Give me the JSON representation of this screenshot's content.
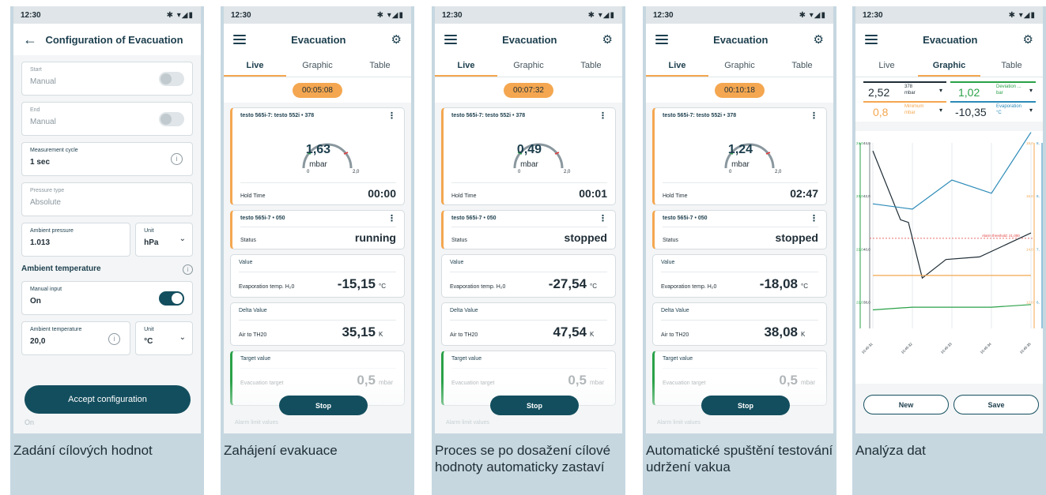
{
  "status": {
    "time": "12:30",
    "icons": "✱ ▾◢▮"
  },
  "panel1": {
    "title": "Configuration of Evacuation",
    "start": {
      "label": "Start",
      "value": "Manual"
    },
    "end": {
      "label": "End",
      "value": "Manual"
    },
    "cycle": {
      "label": "Measurement cycle",
      "value": "1 sec"
    },
    "ptype": {
      "label": "Pressure type",
      "value": "Absolute"
    },
    "ambient_pressure": {
      "label": "Ambient pressure",
      "value": "1.013",
      "unit_label": "Unit",
      "unit": "hPa"
    },
    "section": "Ambient temperature",
    "manual": {
      "label": "Manual input",
      "value": "On"
    },
    "ambient_temp": {
      "label": "Ambient temperature",
      "value": "20,0",
      "unit_label": "Unit",
      "unit": "°C"
    },
    "faded": "On",
    "accept": "Accept configuration",
    "caption": "Zadání cílových hodnot"
  },
  "tabs": {
    "live": "Live",
    "graphic": "Graphic",
    "table": "Table"
  },
  "app_title": "Evacuation",
  "labels": {
    "probe1": "testo 565i-7: testo 552i",
    "probe1_id": "378",
    "hold": "Hold Time",
    "probe2": "testo 565i-7",
    "probe2_id": "050",
    "status": "Status",
    "value": "Value",
    "evap": "Evaporation temp. H₂0",
    "delta": "Delta Value",
    "air": "Air to TH20",
    "target": "Target value",
    "evac_target": "Evacuation target",
    "target_val": "0,5",
    "target_unit": "mbar",
    "alarm": "Alarm limit values",
    "gauge_unit": "mbar",
    "gauge_min": "0",
    "gauge_max": "2,0",
    "unit_c": "°C",
    "unit_k": "K",
    "stop": "Stop"
  },
  "panel2": {
    "timer": "00:05:08",
    "gauge": "1,63",
    "hold": "00:00",
    "status": "running",
    "evap": "-15,15",
    "delta": "35,15",
    "caption": "Zahájení evakuace"
  },
  "panel3": {
    "timer": "00:07:32",
    "gauge": "0,49",
    "hold": "00:01",
    "status": "stopped",
    "evap": "-27,54",
    "delta": "47,54",
    "caption": "Proces se po dosažení cílové hodnoty automaticky zastaví"
  },
  "panel4": {
    "timer": "00:10:18",
    "gauge": "1,24",
    "hold": "02:47",
    "status": "stopped",
    "evap": "-18,08",
    "delta": "38,08",
    "caption": "Automatické spuštění testování udržení vakua"
  },
  "panel5": {
    "v1": "2,52",
    "v1_id": "378",
    "v1_unit": "mbar",
    "v2": "1,02",
    "v2_name": "Deviation ...",
    "v2_unit": "bar",
    "v3": "0,8",
    "v3_name": "Minimum",
    "v3_unit": "mbar",
    "v4": "-10,35",
    "v4_name": "Evaporation",
    "v4_unit": "°C",
    "alarm": "Alarm threshold: 21,000",
    "y_left": [
      "24,0",
      "23,0",
      "22,0",
      "21,0"
    ],
    "y_left2": [
      "44,0",
      "42,0",
      "40,0",
      "38,0"
    ],
    "y_right": [
      "18,0",
      "16,0",
      "14,0",
      "12,0"
    ],
    "y_right2": [
      "8,",
      "8,",
      "7,",
      "6,"
    ],
    "x_ticks": [
      "10:45:31",
      "10:45:32",
      "10:45:33",
      "10:45:34",
      "10:45:35"
    ],
    "new": "New",
    "save": "Save",
    "caption": "Analýza dat"
  },
  "chart_data": {
    "type": "line",
    "x": [
      "10:45:31",
      "10:45:32",
      "10:45:33",
      "10:45:34",
      "10:45:35"
    ],
    "ylim": [
      20.5,
      24.0
    ],
    "alarm_threshold": 21.0,
    "series": [
      {
        "color": "#1f2d36",
        "points": [
          [
            0,
            23.85
          ],
          [
            0.7,
            22.55
          ],
          [
            0.9,
            22.5
          ],
          [
            1.25,
            21.45
          ],
          [
            1.85,
            21.8
          ],
          [
            2.7,
            21.85
          ],
          [
            4,
            22.3
          ]
        ]
      },
      {
        "color": "#2b8ab8",
        "points": [
          [
            0,
            22.85
          ],
          [
            1,
            22.75
          ],
          [
            2,
            23.3
          ],
          [
            3,
            23.05
          ],
          [
            4,
            24.2
          ]
        ]
      },
      {
        "color": "#f4a750",
        "points": [
          [
            0,
            21.5
          ],
          [
            4,
            21.5
          ]
        ]
      },
      {
        "color": "#2aa148",
        "points": [
          [
            0,
            20.85
          ],
          [
            1,
            20.9
          ],
          [
            2,
            20.9
          ],
          [
            3,
            20.9
          ],
          [
            4,
            20.95
          ]
        ]
      }
    ]
  }
}
